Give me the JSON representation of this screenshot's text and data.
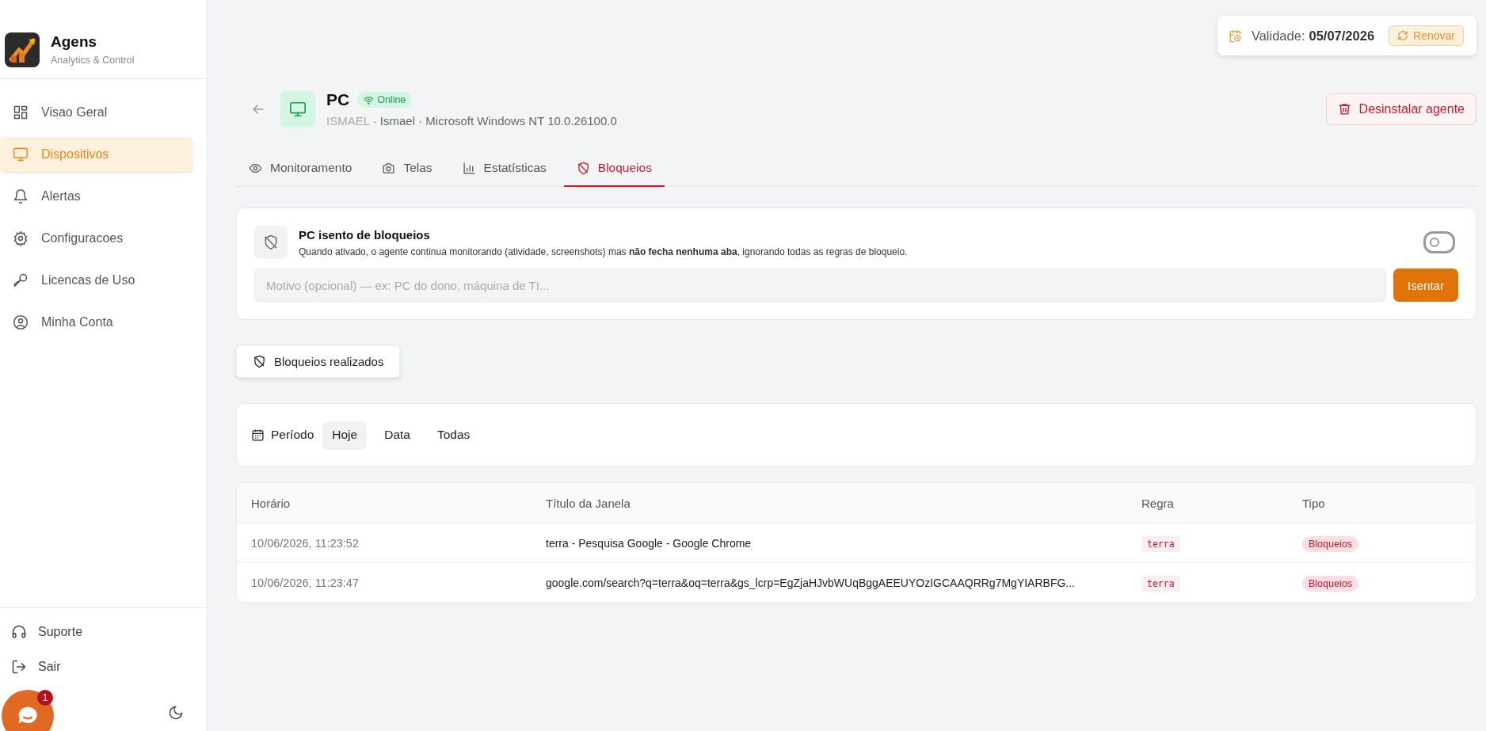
{
  "brand": {
    "name": "Agens",
    "tagline": "Analytics & Control"
  },
  "sidebar": {
    "items": [
      {
        "label": "Visao Geral",
        "selected": false
      },
      {
        "label": "Dispositivos",
        "selected": true
      },
      {
        "label": "Alertas",
        "selected": false
      },
      {
        "label": "Configuracoes",
        "selected": false
      },
      {
        "label": "Licencas de Uso",
        "selected": false
      },
      {
        "label": "Minha Conta",
        "selected": false
      }
    ],
    "footer": [
      {
        "label": "Suporte"
      },
      {
        "label": "Sair"
      }
    ]
  },
  "chat": {
    "badge": "1"
  },
  "validity": {
    "label": "Validade:",
    "date": "05/07/2026",
    "renew": "Renovar"
  },
  "device": {
    "name": "PC",
    "status": "Online",
    "host": "ISMAEL",
    "details": " · Ismael · Microsoft Windows NT 10.0.26100.0",
    "uninstall": "Desinstalar agente"
  },
  "tabs": [
    {
      "label": "Monitoramento",
      "selected": false
    },
    {
      "label": "Telas",
      "selected": false
    },
    {
      "label": "Estatísticas",
      "selected": false
    },
    {
      "label": "Bloqueios",
      "selected": true
    }
  ],
  "exempt": {
    "title": "PC isento de bloqueios",
    "description": "Quando ativado, o agente continua monitorando (atividade, screenshots) mas **não fecha nenhuma aba**, ignorando todas as regras de bloqueio.",
    "on": false,
    "placeholder": "Motivo (opcional) — ex: PC do dono, máquina de TI...",
    "button": "Isentar"
  },
  "section_button": "Bloqueios realizados",
  "period": {
    "label": "Período",
    "options": [
      {
        "label": "Hoje",
        "selected": true
      },
      {
        "label": "Data",
        "selected": false
      },
      {
        "label": "Todas",
        "selected": false
      }
    ]
  },
  "table": {
    "columns": [
      "Horário",
      "Título da Janela",
      "Regra",
      "Tipo"
    ],
    "rows": [
      {
        "time": "10/06/2026, 11:23:52",
        "title": "terra - Pesquisa Google - Google Chrome",
        "rule": "terra",
        "type": "Bloqueios"
      },
      {
        "time": "10/06/2026, 11:23:47",
        "title": "google.com/search?q=terra&oq=terra&gs_lcrp=EgZjaHJvbWUqBggAEEUYOzIGCAAQRRg7MgYIARBFG...",
        "rule": "terra",
        "type": "Bloqueios"
      }
    ]
  }
}
